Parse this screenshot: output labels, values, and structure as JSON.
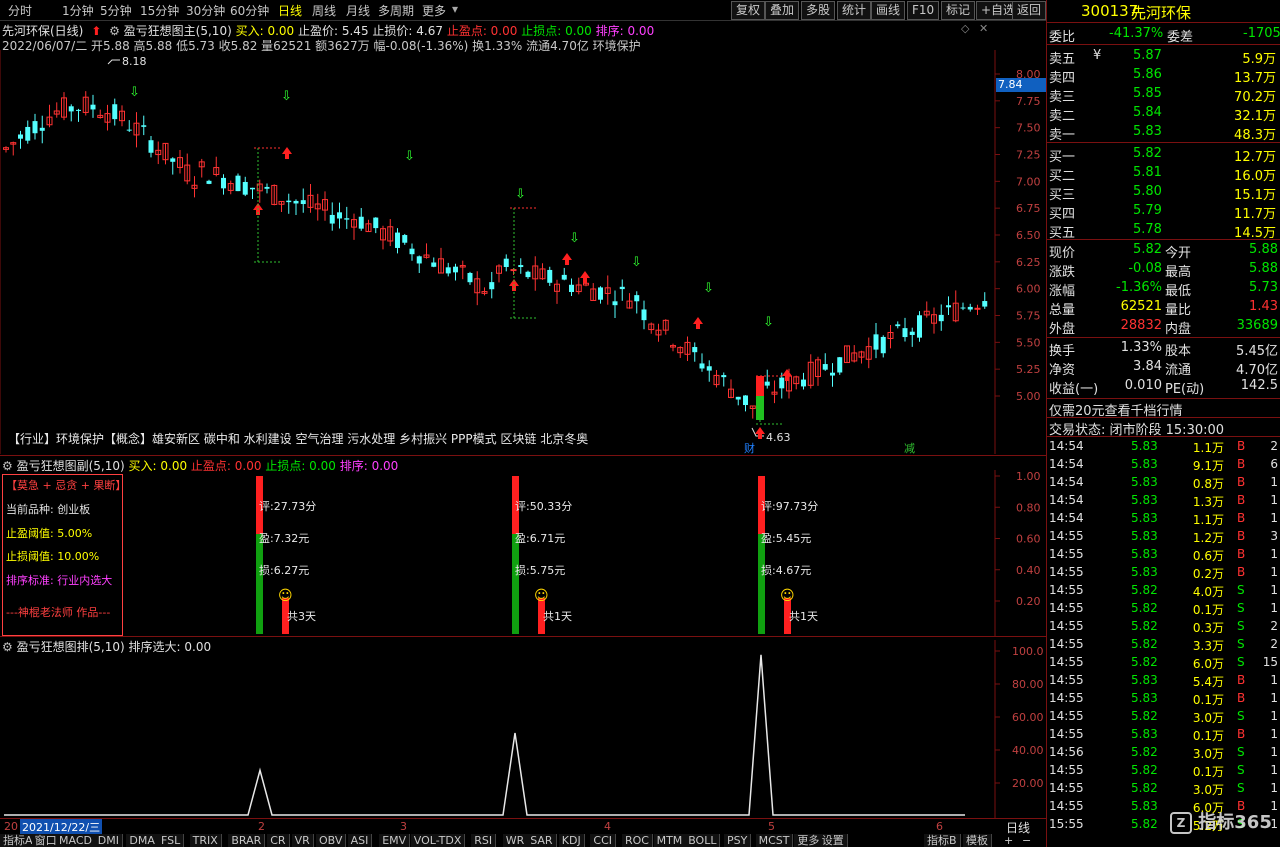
{
  "toolbar": {
    "periods": [
      "分时",
      "1分钟",
      "5分钟",
      "15分钟",
      "30分钟",
      "60分钟",
      "日线",
      "周线",
      "月线",
      "多周期",
      "更多"
    ],
    "active_period": "日线",
    "buttons": [
      "复权",
      "叠加",
      "多股",
      "统计",
      "画线",
      "F10",
      "标记",
      "+自选",
      "返回"
    ]
  },
  "main": {
    "stock_title": "先河环保(日线)",
    "indicator": "盈亏狂想图主(5,10)",
    "buy": "买入: 0.00",
    "tp_price": "止盈价: 5.45",
    "sl_price": "止损价: 4.67",
    "tp_point": "止盈点: 0.00",
    "sl_point": "止损点: 0.00",
    "rank": "排序: 0.00",
    "ohlc_line": "2022/06/07/二 开5.88 高5.88 低5.73 收5.82 量62521 额3627万 幅-0.08(-1.36%) 换1.33% 流通4.70亿 环境保护",
    "high_label": "8.18",
    "low_label": "4.63",
    "current_price_tag": "7.84",
    "y_ticks": [
      "8.00",
      "7.75",
      "7.50",
      "7.25",
      "7.00",
      "6.75",
      "6.50",
      "6.25",
      "6.00",
      "5.75",
      "5.50",
      "5.25",
      "5.00"
    ],
    "concept_line": "【行业】环境保护【概念】雄安新区 碳中和 水利建设 空气治理 污水处理 乡村振兴 PPP模式 区块链 北京冬奥",
    "event_markers": [
      "财",
      "减"
    ]
  },
  "sub1": {
    "title": "盈亏狂想图副(5,10)",
    "buy": "买入: 0.00",
    "tp_point": "止盈点: 0.00",
    "sl_point": "止损点: 0.00",
    "rank": "排序: 0.00",
    "info_box": {
      "header": "【莫急 + 忌贪 + 果断】",
      "variety": "当前品种: 创业板",
      "tp_threshold": "止盈阈值: 5.00%",
      "sl_threshold": "止损阈值: 10.00%",
      "rank_std": "排序标准: 行业内选大",
      "author": "---神棍老法师 作品---"
    },
    "y_ticks": [
      "1.00",
      "0.80",
      "0.60",
      "0.40",
      "0.20"
    ],
    "signals": [
      {
        "score": "评:27.73分",
        "profit": "盈:7.32元",
        "loss": "损:6.27元",
        "days": "共3天"
      },
      {
        "score": "评:50.33分",
        "profit": "盈:6.71元",
        "loss": "损:5.75元",
        "days": "共1天"
      },
      {
        "score": "评:97.73分",
        "profit": "盈:5.45元",
        "loss": "损:4.67元",
        "days": "共1天"
      }
    ]
  },
  "sub2": {
    "title": "盈亏狂想图排(5,10)",
    "rank_label": "排序选大: 0.00",
    "y_ticks": [
      "100.0",
      "80.00",
      "60.00",
      "40.00",
      "20.00"
    ]
  },
  "xaxis": {
    "date_label": "2021/12/22/三",
    "left_label": "20",
    "months": [
      "2",
      "3",
      "4",
      "5",
      "6"
    ],
    "period": "日线"
  },
  "bottom_tabs": [
    "指标A",
    "窗口",
    "MACD",
    "DMI",
    "DMA",
    "FSL",
    "TRIX",
    "BRAR",
    "CR",
    "VR",
    "OBV",
    "ASI",
    "EMV",
    "VOL-TDX",
    "RSI",
    "WR",
    "SAR",
    "KDJ",
    "CCI",
    "ROC",
    "MTM",
    "BOLL",
    "PSY",
    "MCST",
    "更多",
    "设置"
  ],
  "bottom_right_tabs": [
    "指标B",
    "模板"
  ],
  "quote": {
    "code": "300137",
    "name": "先河环保",
    "weibi_label": "委比",
    "weibi": "-41.37%",
    "weicha_label": "委差",
    "weicha": "-1705",
    "asks": [
      {
        "label": "卖五",
        "flag": "¥",
        "price": "5.87",
        "vol": "5.9万"
      },
      {
        "label": "卖四",
        "flag": "",
        "price": "5.86",
        "vol": "13.7万"
      },
      {
        "label": "卖三",
        "flag": "",
        "price": "5.85",
        "vol": "70.2万"
      },
      {
        "label": "卖二",
        "flag": "",
        "price": "5.84",
        "vol": "32.1万"
      },
      {
        "label": "卖一",
        "flag": "",
        "price": "5.83",
        "vol": "48.3万"
      }
    ],
    "bids": [
      {
        "label": "买一",
        "price": "5.82",
        "vol": "12.7万"
      },
      {
        "label": "买二",
        "price": "5.81",
        "vol": "16.0万"
      },
      {
        "label": "买三",
        "price": "5.80",
        "vol": "15.1万"
      },
      {
        "label": "买四",
        "price": "5.79",
        "vol": "11.7万"
      },
      {
        "label": "买五",
        "price": "5.78",
        "vol": "14.5万"
      }
    ],
    "stats": [
      {
        "l1": "现价",
        "v1": "5.82",
        "c1": "green",
        "l2": "今开",
        "v2": "5.88",
        "c2": "green"
      },
      {
        "l1": "涨跌",
        "v1": "-0.08",
        "c1": "green",
        "l2": "最高",
        "v2": "5.88",
        "c2": "green"
      },
      {
        "l1": "涨幅",
        "v1": "-1.36%",
        "c1": "green",
        "l2": "最低",
        "v2": "5.73",
        "c2": "green"
      },
      {
        "l1": "总量",
        "v1": "62521",
        "c1": "yellow",
        "l2": "量比",
        "v2": "1.43",
        "c2": "red"
      },
      {
        "l1": "外盘",
        "v1": "28832",
        "c1": "red",
        "l2": "内盘",
        "v2": "33689",
        "c2": "green"
      }
    ],
    "stats2": [
      {
        "l1": "换手",
        "v1": "1.33%",
        "l2": "股本",
        "v2": "5.45亿"
      },
      {
        "l1": "净资",
        "v1": "3.84",
        "l2": "流通",
        "v2": "4.70亿"
      },
      {
        "l1": "收益(一)",
        "v1": "0.010",
        "l2": "PE(动)",
        "v2": "142.5"
      }
    ],
    "promo": "仅需20元查看千档行情",
    "trade_status": "交易状态: 闭市阶段 15:30:00",
    "ticks": [
      {
        "t": "14:54",
        "p": "5.83",
        "v": "1.1万",
        "d": "B",
        "n": "2"
      },
      {
        "t": "14:54",
        "p": "5.83",
        "v": "9.1万",
        "d": "B",
        "n": "6"
      },
      {
        "t": "14:54",
        "p": "5.83",
        "v": "0.8万",
        "d": "B",
        "n": "1"
      },
      {
        "t": "14:54",
        "p": "5.83",
        "v": "1.3万",
        "d": "B",
        "n": "1"
      },
      {
        "t": "14:54",
        "p": "5.83",
        "v": "1.1万",
        "d": "B",
        "n": "1"
      },
      {
        "t": "14:55",
        "p": "5.83",
        "v": "1.2万",
        "d": "B",
        "n": "3"
      },
      {
        "t": "14:55",
        "p": "5.83",
        "v": "0.6万",
        "d": "B",
        "n": "1"
      },
      {
        "t": "14:55",
        "p": "5.83",
        "v": "0.2万",
        "d": "B",
        "n": "1"
      },
      {
        "t": "14:55",
        "p": "5.82",
        "v": "4.0万",
        "d": "S",
        "n": "1"
      },
      {
        "t": "14:55",
        "p": "5.82",
        "v": "0.1万",
        "d": "S",
        "n": "1"
      },
      {
        "t": "14:55",
        "p": "5.82",
        "v": "0.3万",
        "d": "S",
        "n": "2"
      },
      {
        "t": "14:55",
        "p": "5.82",
        "v": "3.3万",
        "d": "S",
        "n": "2"
      },
      {
        "t": "14:55",
        "p": "5.82",
        "v": "6.0万",
        "d": "S",
        "n": "15"
      },
      {
        "t": "14:55",
        "p": "5.83",
        "v": "5.4万",
        "d": "B",
        "n": "1"
      },
      {
        "t": "14:55",
        "p": "5.83",
        "v": "0.1万",
        "d": "B",
        "n": "1"
      },
      {
        "t": "14:55",
        "p": "5.82",
        "v": "3.0万",
        "d": "S",
        "n": "1"
      },
      {
        "t": "14:55",
        "p": "5.83",
        "v": "0.1万",
        "d": "B",
        "n": "1"
      },
      {
        "t": "14:56",
        "p": "5.82",
        "v": "3.0万",
        "d": "S",
        "n": "1"
      },
      {
        "t": "14:55",
        "p": "5.82",
        "v": "0.1万",
        "d": "S",
        "n": "1"
      },
      {
        "t": "14:55",
        "p": "5.82",
        "v": "3.0万",
        "d": "S",
        "n": "1"
      },
      {
        "t": "14:55",
        "p": "5.83",
        "v": "6.0万",
        "d": "B",
        "n": "1"
      },
      {
        "t": "15:55",
        "p": "5.82",
        "v": "5.2万",
        "d": "S",
        "n": "1"
      }
    ]
  },
  "watermark": "指标365",
  "colors": {
    "up": "#ff3232",
    "down": "#54ffff",
    "grid": "#7a1010",
    "accent_yellow": "#ffff00"
  }
}
